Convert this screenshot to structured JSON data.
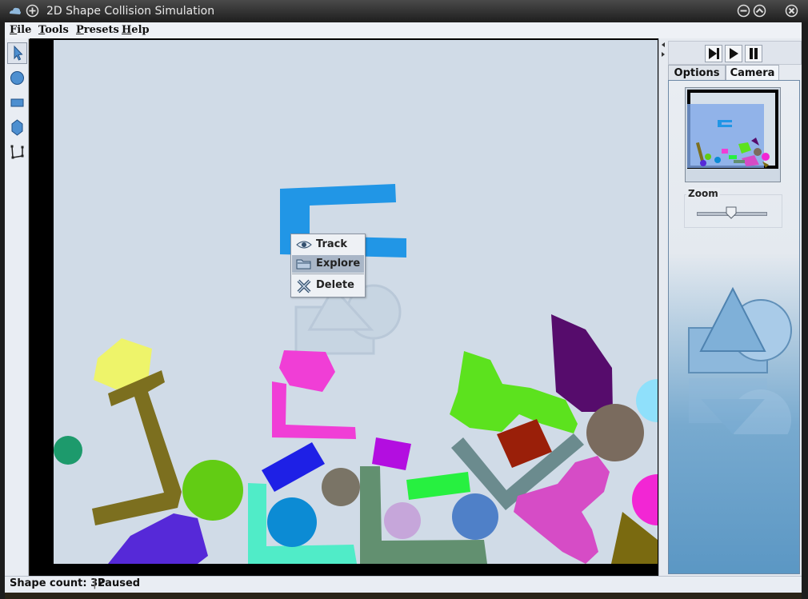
{
  "window": {
    "title": "2D Shape Collision Simulation"
  },
  "menubar": {
    "items": [
      {
        "label": "File",
        "mnemonic": "F",
        "rest": "ile"
      },
      {
        "label": "Tools",
        "mnemonic": "T",
        "rest": "ools"
      },
      {
        "label": "Presets",
        "mnemonic": "P",
        "rest": "resets"
      },
      {
        "label": "Help",
        "mnemonic": "H",
        "rest": "elp"
      }
    ]
  },
  "toolbar": {
    "tools": [
      "select-pointer-icon",
      "circle-tool-icon",
      "rectangle-tool-icon",
      "polygon-tool-icon",
      "link-tool-icon"
    ],
    "active": "select-pointer-icon"
  },
  "context_menu": {
    "items": [
      {
        "label": "Track",
        "icon": "eye-icon"
      },
      {
        "label": "Explore",
        "icon": "folder-icon"
      },
      {
        "label": "Delete",
        "icon": "delete-x-icon"
      }
    ],
    "highlighted": "Explore"
  },
  "right_panel": {
    "controls": [
      "step-forward-icon",
      "play-icon",
      "pause-icon"
    ],
    "tabs": [
      {
        "label": "Options"
      },
      {
        "label": "Camera"
      }
    ],
    "active_tab": "Camera",
    "zoom_label": "Zoom",
    "zoom_level": 0.5
  },
  "statusbar": {
    "shape_count": "Shape count: 32",
    "state": "Paused"
  },
  "colors": {
    "canvas_bg": "#d0dbe7",
    "panel_accent": "#5b97c4"
  }
}
